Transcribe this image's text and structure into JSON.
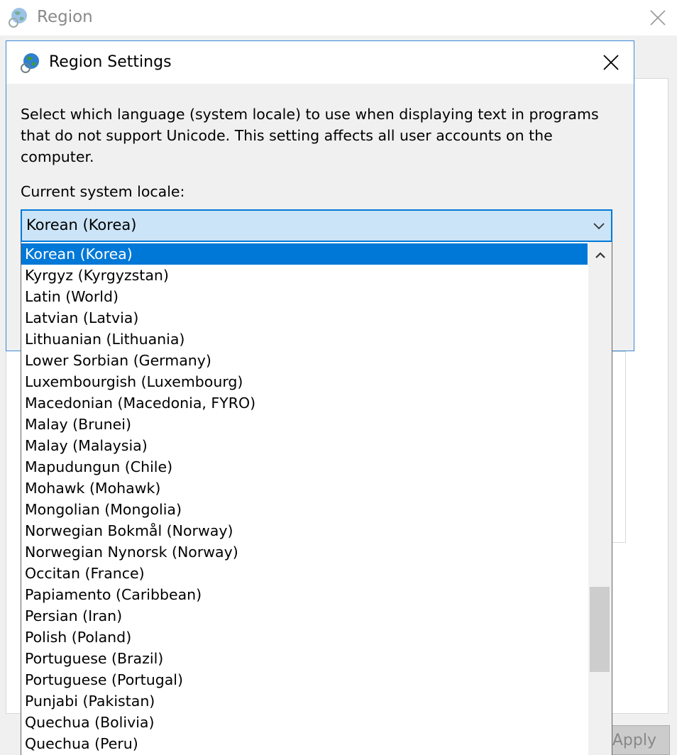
{
  "background_window": {
    "title": "Region",
    "apply_label": "Apply"
  },
  "dialog": {
    "title": "Region Settings",
    "description": "Select which language (system locale) to use when displaying text in programs that do not support Unicode. This setting affects all user accounts on the computer.",
    "locale_label": "Current system locale:",
    "combo": {
      "selected_value": "Korean (Korea)"
    },
    "options": [
      "Korean (Korea)",
      "Kyrgyz (Kyrgyzstan)",
      "Latin (World)",
      "Latvian (Latvia)",
      "Lithuanian (Lithuania)",
      "Lower Sorbian (Germany)",
      "Luxembourgish (Luxembourg)",
      "Macedonian (Macedonia, FYRO)",
      "Malay (Brunei)",
      "Malay (Malaysia)",
      "Mapudungun (Chile)",
      "Mohawk (Mohawk)",
      "Mongolian (Mongolia)",
      "Norwegian Bokmål (Norway)",
      "Norwegian Nynorsk (Norway)",
      "Occitan (France)",
      "Papiamento (Caribbean)",
      "Persian (Iran)",
      "Polish (Poland)",
      "Portuguese (Brazil)",
      "Portuguese (Portugal)",
      "Punjabi (Pakistan)",
      "Quechua (Bolivia)",
      "Quechua (Peru)"
    ],
    "selected_index": 0
  },
  "icons": {
    "window_icon": "globe-icon",
    "close": "close-icon",
    "dropdown_arrow": "chevron-down-icon",
    "scroll_up": "chevron-up-icon"
  },
  "colors": {
    "accent": "#0078d7",
    "combo_background": "#cce4f7",
    "dialog_border": "#3e87d8",
    "dialog_background": "#f0f0f0"
  }
}
